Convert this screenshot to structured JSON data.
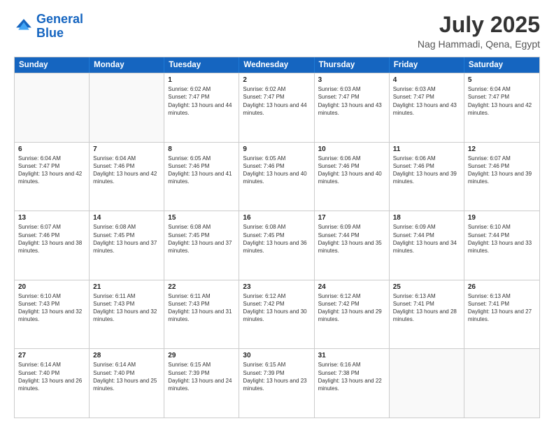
{
  "header": {
    "logo_line1": "General",
    "logo_line2": "Blue",
    "month": "July 2025",
    "location": "Nag Hammadi, Qena, Egypt"
  },
  "weekdays": [
    "Sunday",
    "Monday",
    "Tuesday",
    "Wednesday",
    "Thursday",
    "Friday",
    "Saturday"
  ],
  "rows": [
    [
      {
        "day": "",
        "sunrise": "",
        "sunset": "",
        "daylight": "",
        "empty": true
      },
      {
        "day": "",
        "sunrise": "",
        "sunset": "",
        "daylight": "",
        "empty": true
      },
      {
        "day": "1",
        "sunrise": "Sunrise: 6:02 AM",
        "sunset": "Sunset: 7:47 PM",
        "daylight": "Daylight: 13 hours and 44 minutes.",
        "empty": false
      },
      {
        "day": "2",
        "sunrise": "Sunrise: 6:02 AM",
        "sunset": "Sunset: 7:47 PM",
        "daylight": "Daylight: 13 hours and 44 minutes.",
        "empty": false
      },
      {
        "day": "3",
        "sunrise": "Sunrise: 6:03 AM",
        "sunset": "Sunset: 7:47 PM",
        "daylight": "Daylight: 13 hours and 43 minutes.",
        "empty": false
      },
      {
        "day": "4",
        "sunrise": "Sunrise: 6:03 AM",
        "sunset": "Sunset: 7:47 PM",
        "daylight": "Daylight: 13 hours and 43 minutes.",
        "empty": false
      },
      {
        "day": "5",
        "sunrise": "Sunrise: 6:04 AM",
        "sunset": "Sunset: 7:47 PM",
        "daylight": "Daylight: 13 hours and 42 minutes.",
        "empty": false
      }
    ],
    [
      {
        "day": "6",
        "sunrise": "Sunrise: 6:04 AM",
        "sunset": "Sunset: 7:47 PM",
        "daylight": "Daylight: 13 hours and 42 minutes.",
        "empty": false
      },
      {
        "day": "7",
        "sunrise": "Sunrise: 6:04 AM",
        "sunset": "Sunset: 7:46 PM",
        "daylight": "Daylight: 13 hours and 42 minutes.",
        "empty": false
      },
      {
        "day": "8",
        "sunrise": "Sunrise: 6:05 AM",
        "sunset": "Sunset: 7:46 PM",
        "daylight": "Daylight: 13 hours and 41 minutes.",
        "empty": false
      },
      {
        "day": "9",
        "sunrise": "Sunrise: 6:05 AM",
        "sunset": "Sunset: 7:46 PM",
        "daylight": "Daylight: 13 hours and 40 minutes.",
        "empty": false
      },
      {
        "day": "10",
        "sunrise": "Sunrise: 6:06 AM",
        "sunset": "Sunset: 7:46 PM",
        "daylight": "Daylight: 13 hours and 40 minutes.",
        "empty": false
      },
      {
        "day": "11",
        "sunrise": "Sunrise: 6:06 AM",
        "sunset": "Sunset: 7:46 PM",
        "daylight": "Daylight: 13 hours and 39 minutes.",
        "empty": false
      },
      {
        "day": "12",
        "sunrise": "Sunrise: 6:07 AM",
        "sunset": "Sunset: 7:46 PM",
        "daylight": "Daylight: 13 hours and 39 minutes.",
        "empty": false
      }
    ],
    [
      {
        "day": "13",
        "sunrise": "Sunrise: 6:07 AM",
        "sunset": "Sunset: 7:46 PM",
        "daylight": "Daylight: 13 hours and 38 minutes.",
        "empty": false
      },
      {
        "day": "14",
        "sunrise": "Sunrise: 6:08 AM",
        "sunset": "Sunset: 7:45 PM",
        "daylight": "Daylight: 13 hours and 37 minutes.",
        "empty": false
      },
      {
        "day": "15",
        "sunrise": "Sunrise: 6:08 AM",
        "sunset": "Sunset: 7:45 PM",
        "daylight": "Daylight: 13 hours and 37 minutes.",
        "empty": false
      },
      {
        "day": "16",
        "sunrise": "Sunrise: 6:08 AM",
        "sunset": "Sunset: 7:45 PM",
        "daylight": "Daylight: 13 hours and 36 minutes.",
        "empty": false
      },
      {
        "day": "17",
        "sunrise": "Sunrise: 6:09 AM",
        "sunset": "Sunset: 7:44 PM",
        "daylight": "Daylight: 13 hours and 35 minutes.",
        "empty": false
      },
      {
        "day": "18",
        "sunrise": "Sunrise: 6:09 AM",
        "sunset": "Sunset: 7:44 PM",
        "daylight": "Daylight: 13 hours and 34 minutes.",
        "empty": false
      },
      {
        "day": "19",
        "sunrise": "Sunrise: 6:10 AM",
        "sunset": "Sunset: 7:44 PM",
        "daylight": "Daylight: 13 hours and 33 minutes.",
        "empty": false
      }
    ],
    [
      {
        "day": "20",
        "sunrise": "Sunrise: 6:10 AM",
        "sunset": "Sunset: 7:43 PM",
        "daylight": "Daylight: 13 hours and 32 minutes.",
        "empty": false
      },
      {
        "day": "21",
        "sunrise": "Sunrise: 6:11 AM",
        "sunset": "Sunset: 7:43 PM",
        "daylight": "Daylight: 13 hours and 32 minutes.",
        "empty": false
      },
      {
        "day": "22",
        "sunrise": "Sunrise: 6:11 AM",
        "sunset": "Sunset: 7:43 PM",
        "daylight": "Daylight: 13 hours and 31 minutes.",
        "empty": false
      },
      {
        "day": "23",
        "sunrise": "Sunrise: 6:12 AM",
        "sunset": "Sunset: 7:42 PM",
        "daylight": "Daylight: 13 hours and 30 minutes.",
        "empty": false
      },
      {
        "day": "24",
        "sunrise": "Sunrise: 6:12 AM",
        "sunset": "Sunset: 7:42 PM",
        "daylight": "Daylight: 13 hours and 29 minutes.",
        "empty": false
      },
      {
        "day": "25",
        "sunrise": "Sunrise: 6:13 AM",
        "sunset": "Sunset: 7:41 PM",
        "daylight": "Daylight: 13 hours and 28 minutes.",
        "empty": false
      },
      {
        "day": "26",
        "sunrise": "Sunrise: 6:13 AM",
        "sunset": "Sunset: 7:41 PM",
        "daylight": "Daylight: 13 hours and 27 minutes.",
        "empty": false
      }
    ],
    [
      {
        "day": "27",
        "sunrise": "Sunrise: 6:14 AM",
        "sunset": "Sunset: 7:40 PM",
        "daylight": "Daylight: 13 hours and 26 minutes.",
        "empty": false
      },
      {
        "day": "28",
        "sunrise": "Sunrise: 6:14 AM",
        "sunset": "Sunset: 7:40 PM",
        "daylight": "Daylight: 13 hours and 25 minutes.",
        "empty": false
      },
      {
        "day": "29",
        "sunrise": "Sunrise: 6:15 AM",
        "sunset": "Sunset: 7:39 PM",
        "daylight": "Daylight: 13 hours and 24 minutes.",
        "empty": false
      },
      {
        "day": "30",
        "sunrise": "Sunrise: 6:15 AM",
        "sunset": "Sunset: 7:39 PM",
        "daylight": "Daylight: 13 hours and 23 minutes.",
        "empty": false
      },
      {
        "day": "31",
        "sunrise": "Sunrise: 6:16 AM",
        "sunset": "Sunset: 7:38 PM",
        "daylight": "Daylight: 13 hours and 22 minutes.",
        "empty": false
      },
      {
        "day": "",
        "sunrise": "",
        "sunset": "",
        "daylight": "",
        "empty": true
      },
      {
        "day": "",
        "sunrise": "",
        "sunset": "",
        "daylight": "",
        "empty": true
      }
    ]
  ]
}
